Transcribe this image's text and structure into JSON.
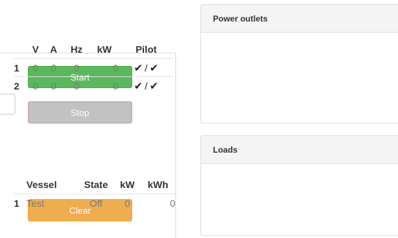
{
  "controls": {
    "start_label": "Start",
    "stop_label": "Stop",
    "clear_label": "Clear"
  },
  "power_outlets": {
    "title": "Power outlets",
    "columns": [
      "V",
      "A",
      "Hz",
      "kW",
      "Pilot"
    ],
    "rows": [
      {
        "id": "1",
        "v": "0",
        "a": "0",
        "hz": "0",
        "kw": "0",
        "pilot_icon_1": "check-icon",
        "pilot_sep": "/",
        "pilot_icon_2": "check-icon"
      },
      {
        "id": "2",
        "v": "0",
        "a": "0",
        "hz": "0",
        "kw": "0",
        "pilot_icon_1": "check-icon",
        "pilot_sep": "/",
        "pilot_icon_2": "check-icon"
      }
    ]
  },
  "loads": {
    "title": "Loads",
    "columns": [
      "Vessel",
      "State",
      "kW",
      "kWh"
    ],
    "rows": [
      {
        "id": "1",
        "vessel": "Test",
        "state": "Off",
        "kw": "0",
        "kwh": "0"
      }
    ]
  },
  "colors": {
    "start": "#5cb85c",
    "stop": "#c2c2c2",
    "clear": "#f0ad4e",
    "heading_bg": "#f5f5f5"
  }
}
